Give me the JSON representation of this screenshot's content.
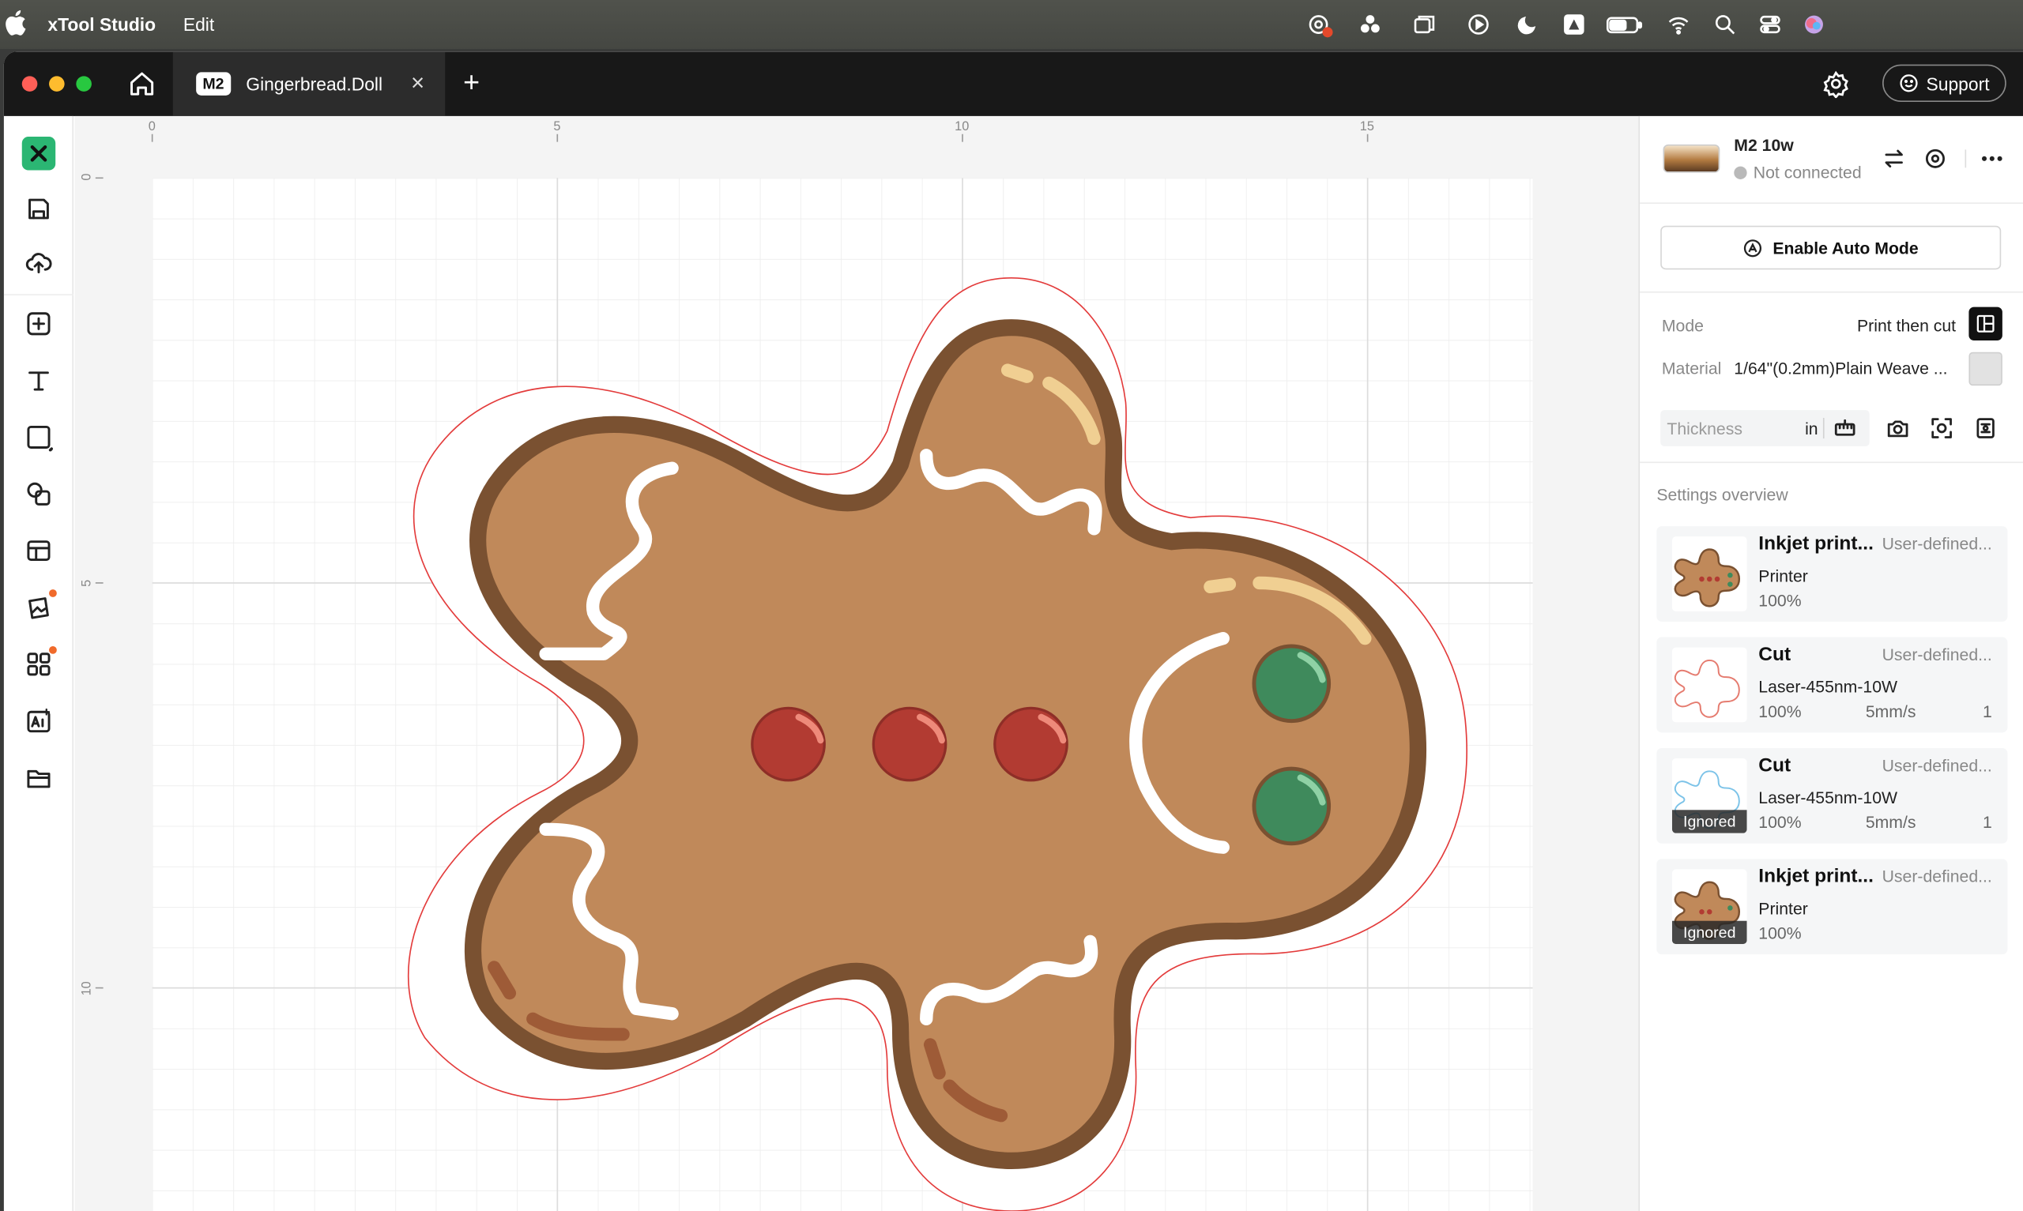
{
  "menubar": {
    "app_name": "xTool Studio",
    "menu_edit": "Edit"
  },
  "tabbar": {
    "tab_badge": "M2",
    "tab_title": "Gingerbread.Doll",
    "close_glyph": "×",
    "new_tab_glyph": "+",
    "support_label": "Support"
  },
  "ruler": {
    "top": [
      "0",
      "5",
      "10",
      "15"
    ],
    "left": [
      "0",
      "5",
      "10"
    ]
  },
  "device": {
    "name": "M2 10w",
    "status": "Not connected",
    "auto_mode_label": "Enable Auto Mode"
  },
  "settings": {
    "mode_label": "Mode",
    "mode_value": "Print then cut",
    "material_label": "Material",
    "material_value": "1/64\"(0.2mm)Plain Weave ...",
    "thickness_placeholder": "Thickness",
    "thickness_unit": "in",
    "overview_title": "Settings overview"
  },
  "layers": [
    {
      "title": "Inkjet print...",
      "source": "User-defined...",
      "line2": "Printer",
      "power": "100%",
      "speed": "",
      "count": "",
      "ignored": false,
      "thumb": "gingerbread-color"
    },
    {
      "title": "Cut",
      "source": "User-defined...",
      "line2": "Laser-455nm-10W",
      "power": "100%",
      "speed": "5mm/s",
      "count": "1",
      "ignored": false,
      "thumb": "red-outline"
    },
    {
      "title": "Cut",
      "source": "User-defined...",
      "line2": "Laser-455nm-10W",
      "power": "100%",
      "speed": "5mm/s",
      "count": "1",
      "ignored": true,
      "thumb": "blue-outline"
    },
    {
      "title": "Inkjet print...",
      "source": "User-defined...",
      "line2": "Printer",
      "power": "100%",
      "speed": "",
      "count": "",
      "ignored": true,
      "thumb": "gingerbread-color"
    }
  ],
  "ignored_label": "Ignored",
  "colors": {
    "cookie": "#c0895a",
    "cookie_outline": "#7a5131",
    "button_red": "#b23b32",
    "eye_green": "#3f8a5c",
    "cut_line": "#e33b3b",
    "accent_green": "#2bb673"
  }
}
